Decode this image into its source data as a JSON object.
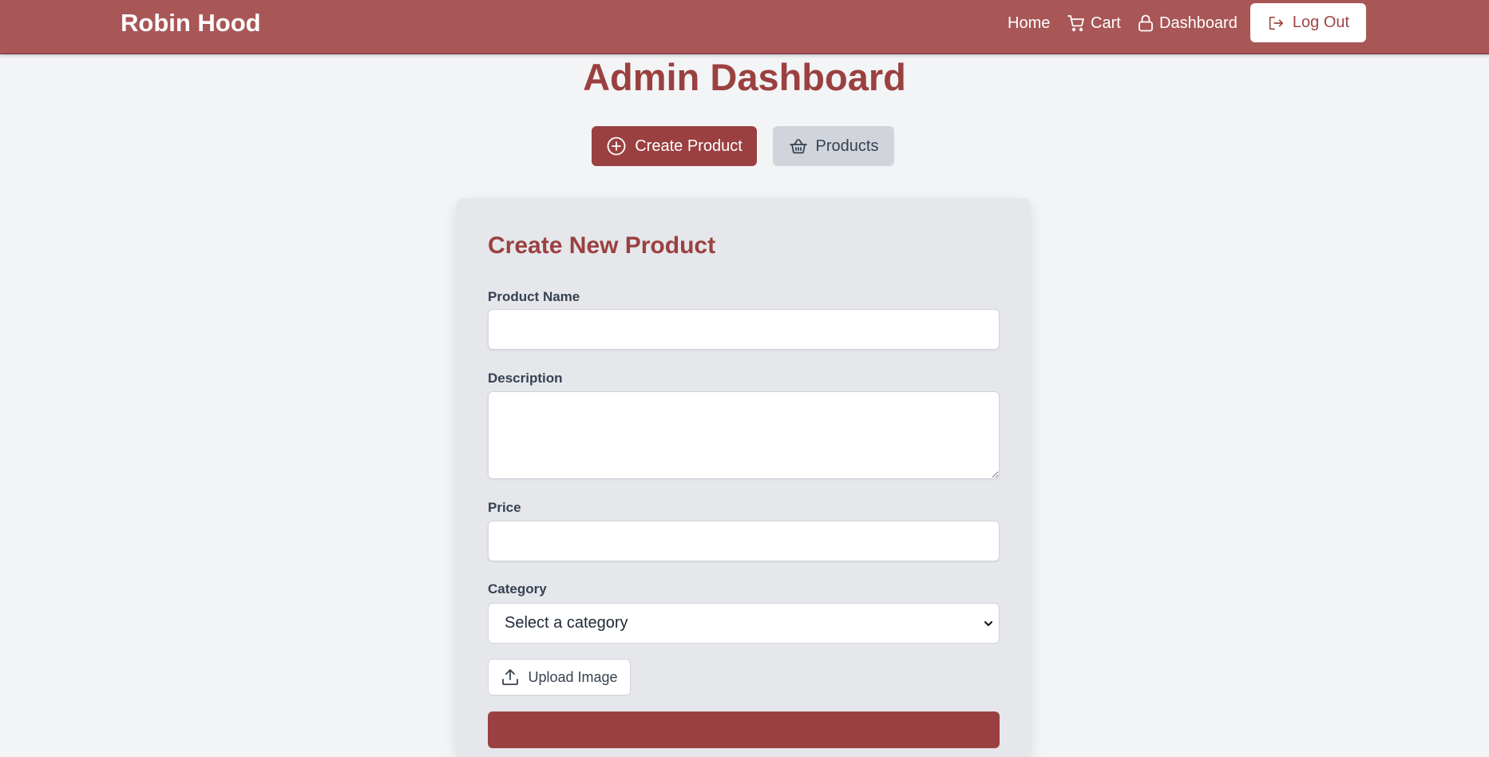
{
  "navbar": {
    "brand": "Robin Hood",
    "links": {
      "home": "Home",
      "cart": "Cart",
      "dashboard": "Dashboard"
    },
    "logout_label": "Log Out",
    "icons": {
      "cart": "cart-icon",
      "dashboard": "lock-icon",
      "logout": "logout-icon"
    }
  },
  "page": {
    "title": "Admin Dashboard"
  },
  "tabs": {
    "create_label": "Create Product",
    "products_label": "Products",
    "active": "create",
    "icons": {
      "create": "plus-circle-icon",
      "products": "basket-icon"
    }
  },
  "form": {
    "title": "Create New Product",
    "product_name": {
      "label": "Product Name",
      "value": "",
      "placeholder": ""
    },
    "description": {
      "label": "Description",
      "value": "",
      "placeholder": ""
    },
    "price": {
      "label": "Price",
      "value": "",
      "placeholder": ""
    },
    "category": {
      "label": "Category",
      "selected": "Select a category"
    },
    "upload_label": "Upload Image",
    "upload_icon": "upload-icon"
  },
  "colors": {
    "navbar_bg": "#a85656",
    "primary": "#9b4040",
    "page_bg": "#f3f4f6",
    "card_bg": "#e5e7eb",
    "secondary_button": "#d1d5db"
  }
}
